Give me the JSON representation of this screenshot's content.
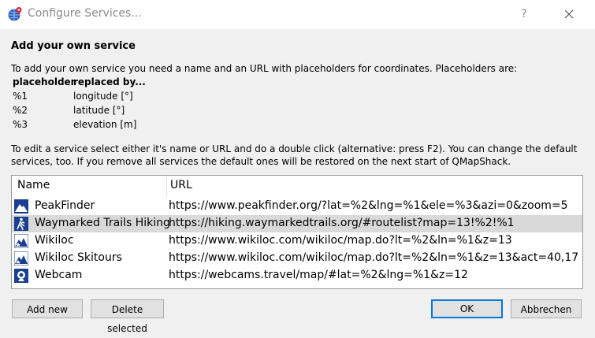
{
  "window": {
    "title": "Configure Services...",
    "help_label": "?",
    "close_icon": "close-icon",
    "app_icon": "globe-pin-icon"
  },
  "intro": {
    "heading": "Add your own service",
    "description": "To add your own service you need a name and an URL with placeholders for coordinates. Placeholders are:"
  },
  "placeholders": {
    "col_placeholder": "placeholder",
    "col_replaced": "replaced by...",
    "rows": [
      {
        "key": "%1",
        "value": "longitude [°]"
      },
      {
        "key": "%2",
        "value": "latitude [°]"
      },
      {
        "key": "%3",
        "value": "elevation [m]"
      }
    ]
  },
  "edit_hint": {
    "line1": "To edit a service select either it's name or URL and do a double click (alternative: press F2). You can change the default",
    "line2": "services, too. If you remove all services the default ones will be restored on the next start of QMapShack."
  },
  "service_list": {
    "col_name": "Name",
    "col_url": "URL",
    "rows": [
      {
        "name": "PeakFinder",
        "url": "https://www.peakfinder.org/?lat=%2&lng=%1&ele=%3&azi=0&zoom=5",
        "icon": "mountain-icon",
        "selected": false
      },
      {
        "name": "Waymarked Trails Hiking",
        "url": "https://hiking.waymarkedtrails.org/#routelist?map=13!%2!%1",
        "icon": "hiking-icon",
        "selected": true
      },
      {
        "name": "Wikiloc",
        "url": "https://www.wikiloc.com/wikiloc/map.do?lt=%2&ln=%1&z=13",
        "icon": "mountain-star-icon",
        "selected": false
      },
      {
        "name": "Wikiloc Skitours",
        "url": "https://www.wikiloc.com/wikiloc/map.do?lt=%2&ln=%1&z=13&act=40,17",
        "icon": "mountain-star-icon",
        "selected": false
      },
      {
        "name": "Webcam",
        "url": "https://webcams.travel/map/#lat=%2&lng=%1&z=12",
        "icon": "webcam-icon",
        "selected": false
      }
    ]
  },
  "buttons": {
    "add_new": "Add new",
    "delete_selected": "Delete selected",
    "ok": "OK",
    "cancel": "Abbrechen"
  },
  "colors": {
    "accent": "#0078d7",
    "selection": "#d9d9d9",
    "icon_blue": "#1a3f8f"
  }
}
